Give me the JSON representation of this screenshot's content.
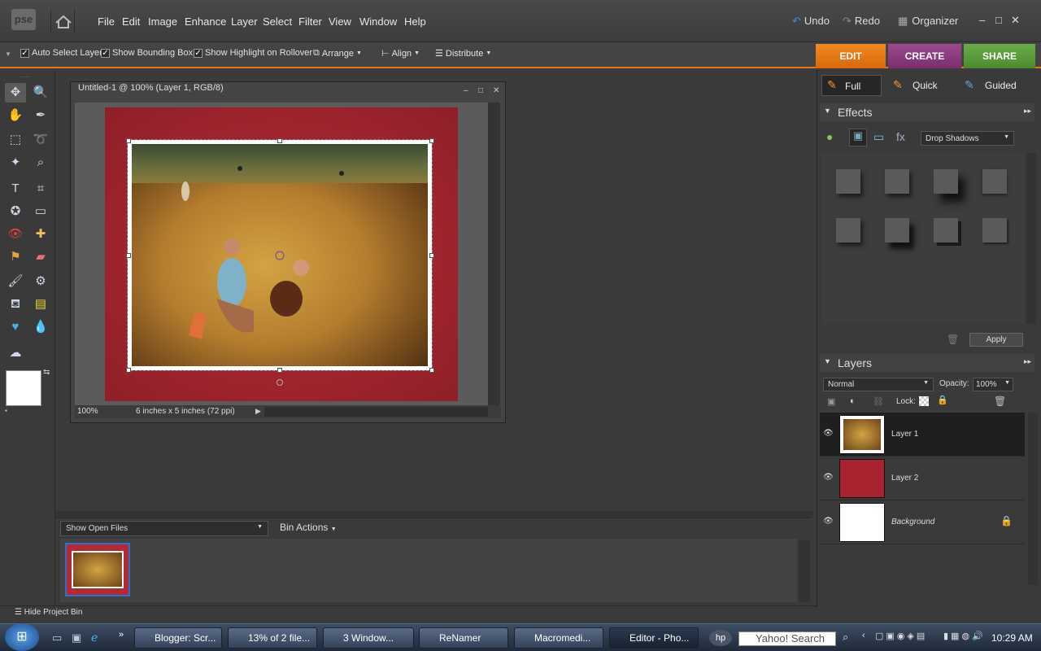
{
  "menubar": {
    "logo": "pse",
    "items": [
      "File",
      "Edit",
      "Image",
      "Enhance",
      "Layer",
      "Select",
      "Filter",
      "View",
      "Window",
      "Help"
    ],
    "undo": "Undo",
    "redo": "Redo",
    "organizer": "Organizer"
  },
  "options": {
    "auto_select": "Auto Select Layer",
    "show_bbox": "Show Bounding Box",
    "show_highlight": "Show Highlight on Rollover",
    "arrange": "Arrange",
    "align": "Align",
    "distribute": "Distribute"
  },
  "modes": {
    "edit": "EDIT",
    "create": "CREATE",
    "share": "SHARE"
  },
  "edit_modes": {
    "full": "Full",
    "quick": "Quick",
    "guided": "Guided"
  },
  "document": {
    "title": "Untitled-1 @ 100% (Layer 1, RGB/8)",
    "zoom": "100%",
    "size_info": "6 inches x 5 inches (72 ppi)"
  },
  "effects": {
    "header": "Effects",
    "dropdown": "Drop Shadows",
    "apply": "Apply"
  },
  "layers": {
    "header": "Layers",
    "blend_mode": "Normal",
    "opacity_label": "Opacity:",
    "opacity_value": "100%",
    "lock_label": "Lock:",
    "items": [
      {
        "name": "Layer 1"
      },
      {
        "name": "Layer 2"
      },
      {
        "name": "Background"
      }
    ]
  },
  "bin": {
    "dropdown": "Show Open Files",
    "actions": "Bin Actions",
    "hide": "Hide Project Bin"
  },
  "taskbar": {
    "items": [
      "Blogger: Scr...",
      "13% of 2 file...",
      "3 Window...",
      "ReNamer",
      "Macromedi...",
      "Editor - Pho..."
    ],
    "search": "Yahoo! Search",
    "clock": "10:29 AM"
  },
  "colors": {
    "accent": "#e77817",
    "create": "#8b3a7e",
    "share": "#5a9a3a"
  }
}
